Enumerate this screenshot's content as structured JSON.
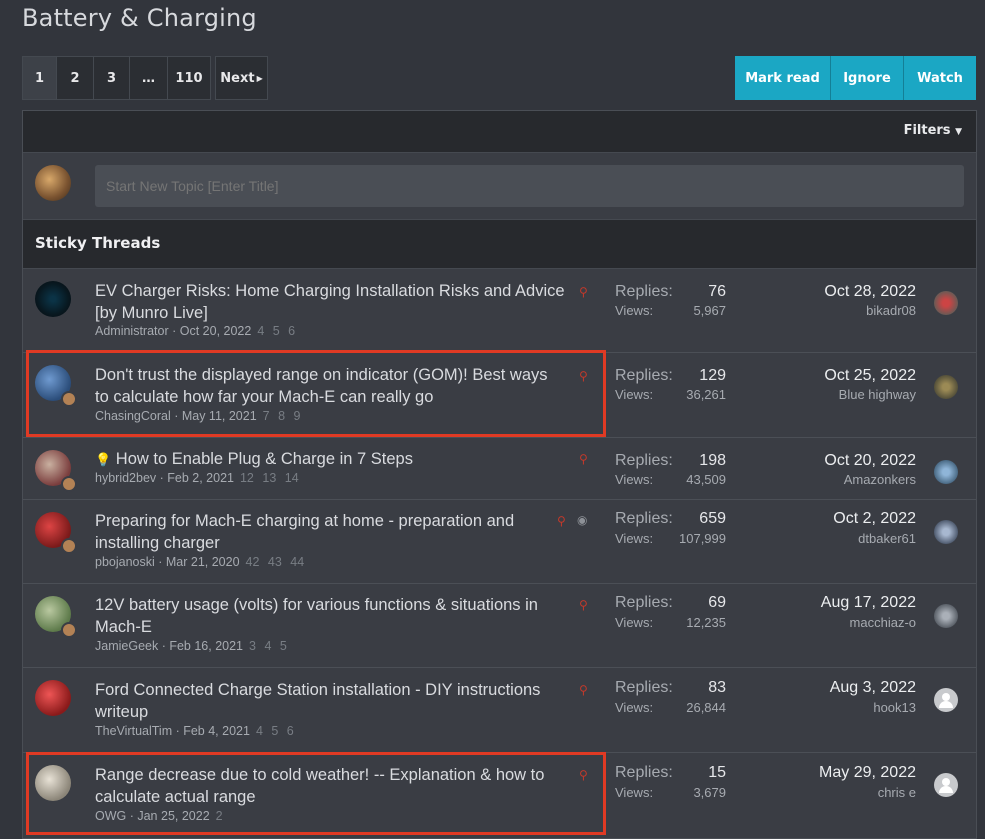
{
  "page": {
    "title": "Battery & Charging"
  },
  "pagination": {
    "pages": [
      "1",
      "2",
      "3",
      "…",
      "110"
    ],
    "current": "1",
    "next_label": "Next"
  },
  "actions": {
    "mark_read": "Mark read",
    "ignore": "Ignore",
    "watch": "Watch"
  },
  "filters": {
    "label": "Filters"
  },
  "new_topic": {
    "placeholder": "Start New Topic [Enter Title]"
  },
  "section": {
    "sticky_label": "Sticky Threads"
  },
  "labels": {
    "replies": "Replies:",
    "views": "Views:"
  },
  "colors": {
    "accent": "#1ba7c4",
    "pin": "#c0392b",
    "highlight": "#e03a24"
  },
  "threads": [
    {
      "title": "EV Charger Risks: Home Charging Installation Risks and Advice [by Munro Live]",
      "author": "Administrator",
      "date": "Oct 20, 2022",
      "pages": "4 5 6",
      "replies": "76",
      "views": "5,967",
      "last_date": "Oct 28, 2022",
      "last_user": "bikadr08",
      "icons": [
        "pin-icon"
      ],
      "prefix_icon": "",
      "highlighted": false
    },
    {
      "title": "Don't trust the displayed range on indicator (GOM)! Best ways to calculate how far your Mach-E can really go",
      "author": "ChasingCoral",
      "date": "May 11, 2021",
      "pages": "7 8 9",
      "replies": "129",
      "views": "36,261",
      "last_date": "Oct 25, 2022",
      "last_user": "Blue highway",
      "icons": [
        "pin-icon"
      ],
      "prefix_icon": "",
      "highlighted": true
    },
    {
      "title": "How to Enable Plug & Charge in 7 Steps",
      "author": "hybrid2bev",
      "date": "Feb 2, 2021",
      "pages": "12 13 14",
      "replies": "198",
      "views": "43,509",
      "last_date": "Oct 20, 2022",
      "last_user": "Amazonkers",
      "icons": [
        "pin-icon"
      ],
      "prefix_icon": "lightbulb-icon",
      "highlighted": false
    },
    {
      "title": "Preparing for Mach-E charging at home - preparation and installing charger",
      "author": "pbojanoski",
      "date": "Mar 21, 2020",
      "pages": "42 43 44",
      "replies": "659",
      "views": "107,999",
      "last_date": "Oct 2, 2022",
      "last_user": "dtbaker61",
      "icons": [
        "pin-icon",
        "eye-icon"
      ],
      "prefix_icon": "",
      "highlighted": false
    },
    {
      "title": "12V battery usage (volts) for various functions & situations in Mach-E",
      "author": "JamieGeek",
      "date": "Feb 16, 2021",
      "pages": "3 4 5",
      "replies": "69",
      "views": "12,235",
      "last_date": "Aug 17, 2022",
      "last_user": "macchiaz-o",
      "icons": [
        "pin-icon"
      ],
      "prefix_icon": "",
      "highlighted": false
    },
    {
      "title": "Ford Connected Charge Station installation - DIY instructions writeup",
      "author": "TheVirtualTim",
      "date": "Feb 4, 2021",
      "pages": "4 5 6",
      "replies": "83",
      "views": "26,844",
      "last_date": "Aug 3, 2022",
      "last_user": "hook13",
      "icons": [
        "pin-icon"
      ],
      "prefix_icon": "",
      "highlighted": false
    },
    {
      "title": "Range decrease due to cold weather! -- Explanation & how to calculate actual range",
      "author": "OWG",
      "date": "Jan 25, 2022",
      "pages": "2",
      "replies": "15",
      "views": "3,679",
      "last_date": "May 29, 2022",
      "last_user": "chris e",
      "icons": [
        "pin-icon"
      ],
      "prefix_icon": "",
      "highlighted": true
    }
  ]
}
